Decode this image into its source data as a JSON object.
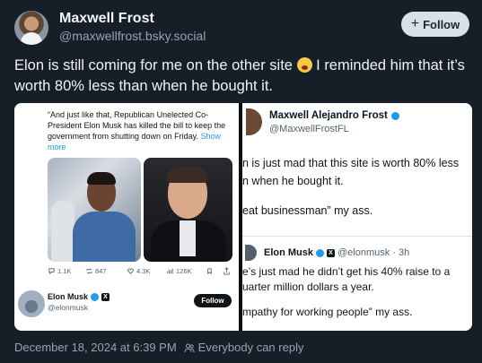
{
  "author": {
    "display_name": "Maxwell Frost",
    "handle": "@maxwellfrost.bsky.social"
  },
  "follow_button": {
    "label": "Follow"
  },
  "post": {
    "text_part1": "Elon is still coming for me on the other site ",
    "emoji": "shocked-face-emoji",
    "text_part2": " I reminded him that it’s worth 80% less than when he bought it."
  },
  "embedded_left": {
    "quote_text": "“And just like that, Republican Unelected Co-President Elon Musk has killed the bill to keep the government from shutting down on Friday.",
    "show_more": "Show more",
    "actions": {
      "replies": "1.1K",
      "reposts": "847",
      "likes": "4.3K",
      "views": "126K"
    },
    "author_name": "Elon Musk",
    "author_handle": "@elonmusk",
    "follow_label": "Follow"
  },
  "embedded_right": {
    "name": "Maxwell Alejandro Frost",
    "handle": "@MaxwellFrostFL",
    "line1": "n is just mad that this site is worth 80% less",
    "line2": "n when he bought it.",
    "line3": "eat businessman” my ass.",
    "reply_name": "Elon Musk",
    "reply_handle": "@elonmusk · 3h",
    "reply_line1": "e’s just mad he didn’t get his 40% raise to a",
    "reply_line2": "uarter million dollars a year.",
    "reply_line3": "mpathy for working people” my ass."
  },
  "footer": {
    "timestamp": "December 18, 2024 at 6:39 PM",
    "reply_setting": "Everybody can reply"
  },
  "colors": {
    "background": "#161e27",
    "accent": "#1d9bf0",
    "muted": "#94a4b5"
  }
}
